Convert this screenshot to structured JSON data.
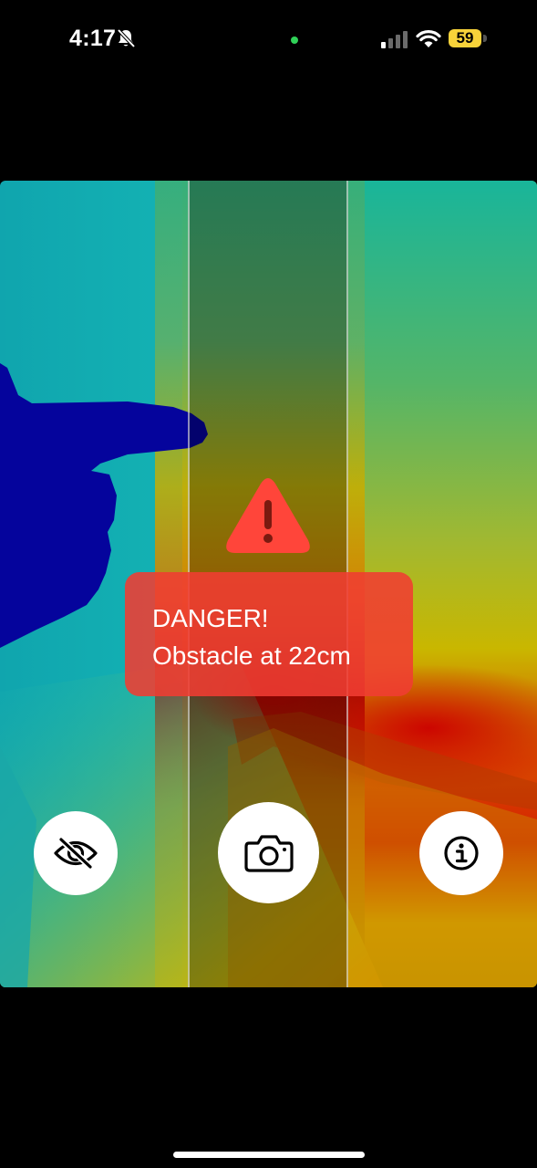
{
  "status_bar": {
    "time": "4:17",
    "battery_level": "59",
    "icons": [
      "bell-slash-icon",
      "mic-active-dot",
      "cellular-signal-icon",
      "wifi-icon",
      "battery-icon"
    ],
    "colors": {
      "mic_dot": "#30d158",
      "battery": "#f8d33a"
    }
  },
  "alert": {
    "title": "DANGER!",
    "message": "Obstacle at 22cm",
    "icon": "warning-triangle-icon",
    "color": "#f03c32"
  },
  "controls": {
    "toggle_view_icon": "eye-slash-icon",
    "capture_icon": "camera-icon",
    "info_icon": "info-circle-icon"
  }
}
